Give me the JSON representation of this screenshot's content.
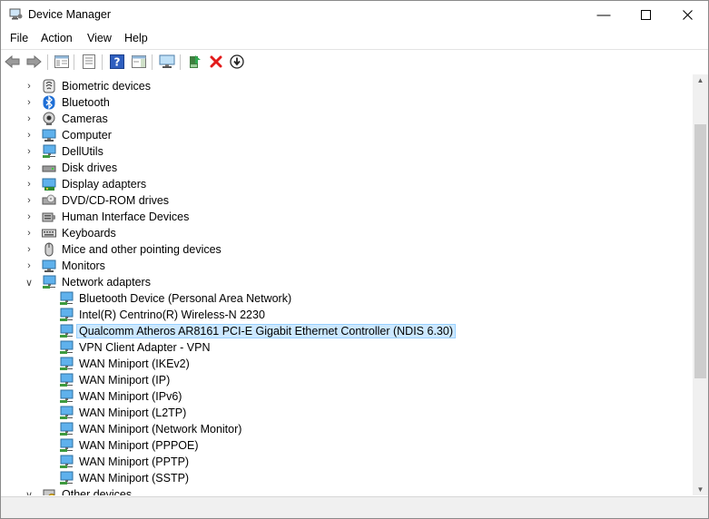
{
  "window": {
    "title": "Device Manager"
  },
  "menu": [
    "File",
    "Action",
    "View",
    "Help"
  ],
  "toolbar": [
    "back-icon",
    "forward-icon",
    "show-hide-tree-icon",
    "properties-icon",
    "help-icon",
    "action-pane-icon",
    "monitor-icon",
    "update-driver-icon",
    "uninstall-icon",
    "download-icon"
  ],
  "tree": {
    "categories": [
      {
        "label": "Biometric devices",
        "icon": "fingerprint-icon",
        "expanded": false
      },
      {
        "label": "Bluetooth",
        "icon": "bluetooth-icon",
        "expanded": false
      },
      {
        "label": "Cameras",
        "icon": "camera-icon",
        "expanded": false
      },
      {
        "label": "Computer",
        "icon": "computer-icon",
        "expanded": false
      },
      {
        "label": "DellUtils",
        "icon": "network-icon",
        "expanded": false
      },
      {
        "label": "Disk drives",
        "icon": "disk-icon",
        "expanded": false
      },
      {
        "label": "Display adapters",
        "icon": "display-adapter-icon",
        "expanded": false
      },
      {
        "label": "DVD/CD-ROM drives",
        "icon": "dvd-icon",
        "expanded": false
      },
      {
        "label": "Human Interface Devices",
        "icon": "hid-icon",
        "expanded": false
      },
      {
        "label": "Keyboards",
        "icon": "keyboard-icon",
        "expanded": false
      },
      {
        "label": "Mice and other pointing devices",
        "icon": "mouse-icon",
        "expanded": false
      },
      {
        "label": "Monitors",
        "icon": "monitor-icon",
        "expanded": false
      },
      {
        "label": "Network adapters",
        "icon": "network-icon",
        "expanded": true
      }
    ],
    "network_children": [
      {
        "label": "Bluetooth Device (Personal Area Network)"
      },
      {
        "label": "Intel(R) Centrino(R) Wireless-N 2230"
      },
      {
        "label": "Qualcomm Atheros AR8161 PCI-E Gigabit Ethernet Controller (NDIS 6.30)",
        "selected": true
      },
      {
        "label": "VPN Client Adapter - VPN"
      },
      {
        "label": "WAN Miniport (IKEv2)"
      },
      {
        "label": "WAN Miniport (IP)"
      },
      {
        "label": "WAN Miniport (IPv6)"
      },
      {
        "label": "WAN Miniport (L2TP)"
      },
      {
        "label": "WAN Miniport (Network Monitor)"
      },
      {
        "label": "WAN Miniport (PPPOE)"
      },
      {
        "label": "WAN Miniport (PPTP)"
      },
      {
        "label": "WAN Miniport (SSTP)"
      }
    ],
    "after": [
      {
        "label": "Other devices",
        "icon": "other-devices-icon",
        "expanded": true
      }
    ]
  },
  "colors": {
    "selection": "#cce8ff",
    "selection_border": "#99d1ff",
    "icon_blue": "#3a8fd6"
  }
}
